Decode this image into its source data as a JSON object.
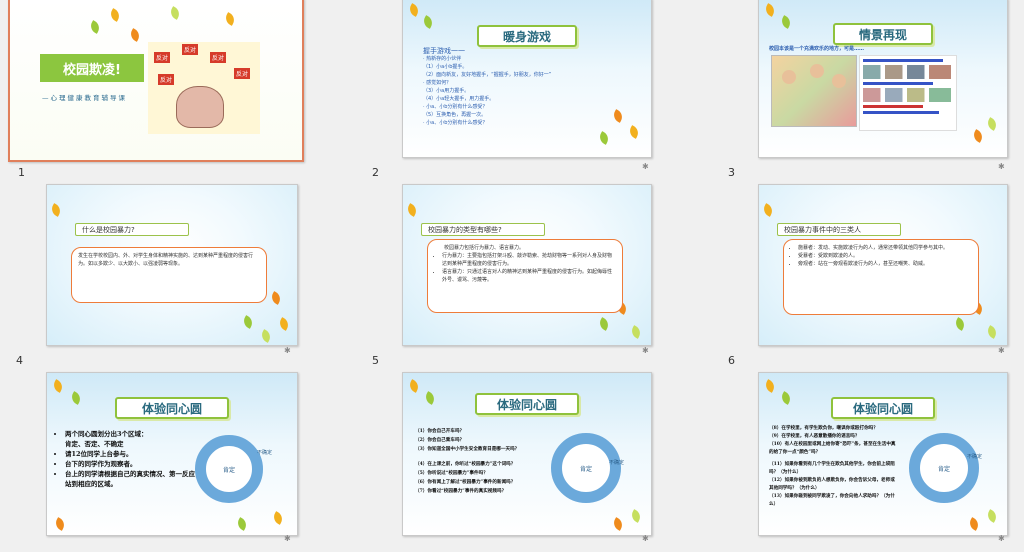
{
  "slides": [
    {
      "num": "1",
      "title": "校园欺凌!",
      "subtitle": "—心理健康教育辅导课",
      "sign": "反对"
    },
    {
      "num": "2",
      "banner": "暖身游戏",
      "lines": [
        "握手游戏一一",
        "· 热新存的小伙伴",
        "（1）小a小b握手。",
        "（2）面向新友，友好地握手，“握握手，好朋友，你好一”",
        "· 感觉如何？",
        "（3）小a用力握手。",
        "（4）小a轻大握手，用力握手。",
        "· 小a、小b分别有什么感受？",
        "（5）互换角色，再握一次。",
        "· 小a、小b分别有什么感受？"
      ]
    },
    {
      "num": "3",
      "banner": "情景再现",
      "caption": "校园本该是一个充满欢乐的地方，可是……"
    },
    {
      "num": "4",
      "tag": "什么是校园暴力?",
      "body": "发生在学校校园内、外、对学生身体和精神实施的、达到某种严重程度的侵害行为。如以多欺少、以大欺小、以强凌弱等现象。"
    },
    {
      "num": "5",
      "tag": "校园暴力的类型有哪些?",
      "intro": "校园暴力包括行为暴力、语言暴力。",
      "items": [
        "行为暴力：主要指包括打架斗殴、敲诈勒索、抢劫财物等一系列对人身及财物达到某种严重程度的侵害行为。",
        "语言暴力：只通过语言对人的精神达到某种严重程度的侵害行为。如起侮辱性外号、谩骂、污蔑等。"
      ]
    },
    {
      "num": "6",
      "tag": "校园暴力事件中的三类人",
      "items": [
        "施暴者：发动、实施欺凌行为的人，通常还带领其他同学参与其中。",
        "受暴者：受欺到欺凌的人。",
        "旁观者：站在一旁观看欺凌行为的人，甚至还嘲笑、助威。"
      ]
    },
    {
      "num": "7",
      "banner": "体验同心圆",
      "items": [
        "两个同心圆划分出3个区域：",
        "肯定、否定、不确定",
        "请12位同学上台参与。",
        "台下的同学作为观察者。",
        "台上的同学请根据自己的真实情况、第一反应，站到相应的区域。"
      ],
      "ring_center": "肯定",
      "ring_side": "不确定"
    },
    {
      "num": "8",
      "banner": "体验同心圆",
      "items": [
        "（1）你会自己开车吗？",
        "（2）你会自己乘车吗？",
        "（3）你知道全国中小学生安全教育日是哪一天吗？",
        "（4）在上课之前，你听过“校园暴力”这个词吗？",
        "（5）你听说过“校园暴力”事件吗？",
        "（6）你有闻上了解过“校园暴力”事件的新闻吗？",
        "（7）你看过“校园暴力”事件的真实视频吗？"
      ],
      "ring_center": "肯定",
      "ring_side": "不确定"
    },
    {
      "num": "9",
      "banner": "体验同心圆",
      "items": [
        "（8）在学校里，有学生欺负你，嘲讽你或殴打你吗？",
        "（9）在学校里，有人恶意散播你的谣言吗？",
        "（10）有人在校园里或网上给你寄“恐吓”条，甚至在生活中真的给了你一点“颜色”吗？",
        "（11）如果你看到有几个学生在欺负其他学生，你会前上袋阻吗？（为什么）",
        "（12）如果你被到欺负的人想欺负你，你会告诉父母，老师或其他同学吗？（为什么）",
        "（13）如果你碰到被同学欺凌了，你会向他人求助吗？（为什么）"
      ],
      "ring_center": "肯定",
      "ring_side": "不确定"
    }
  ]
}
